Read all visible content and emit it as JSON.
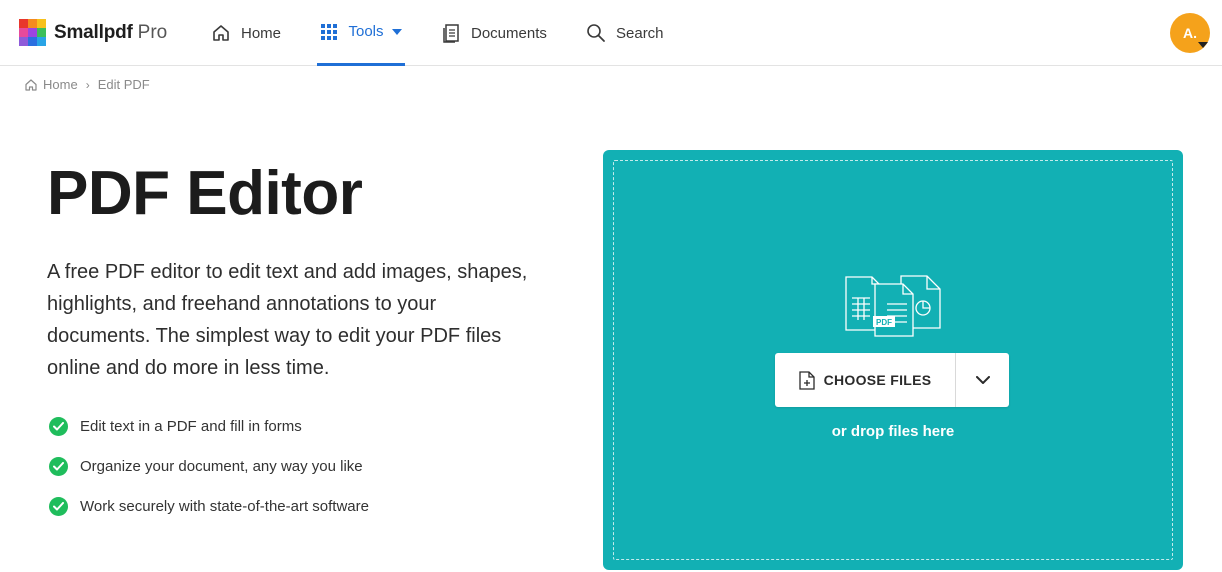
{
  "brand": {
    "name": "Smallpdf",
    "tier": "Pro",
    "logo_colors": [
      "#e8372c",
      "#f58b1f",
      "#f7c11c",
      "#29a4e6",
      "#9c45e0",
      "#e84a9b",
      "#3cbf5a",
      "#2b6fe0",
      "#8e5bd9"
    ]
  },
  "nav": {
    "home": "Home",
    "tools": "Tools",
    "documents": "Documents",
    "search": "Search"
  },
  "user": {
    "initials": "A.",
    "avatar_color": "#f5a21b"
  },
  "breadcrumb": {
    "home": "Home",
    "separator": "›",
    "current": "Edit PDF"
  },
  "hero": {
    "title": "PDF Editor",
    "description": "A free PDF editor to edit text and add images, shapes, highlights, and freehand annotations to your documents. The simplest way to edit your PDF files online and do more in less time.",
    "features": [
      "Edit text in a PDF and fill in forms",
      "Organize your document, any way you like",
      "Work securely with state-of-the-art software"
    ]
  },
  "dropzone": {
    "background": "#12b0b4",
    "illustration_label": "PDF",
    "choose_label": "CHOOSE FILES",
    "drop_hint": "or drop files here"
  },
  "colors": {
    "accent": "#1f6fd6",
    "check": "#1fbd5c"
  }
}
